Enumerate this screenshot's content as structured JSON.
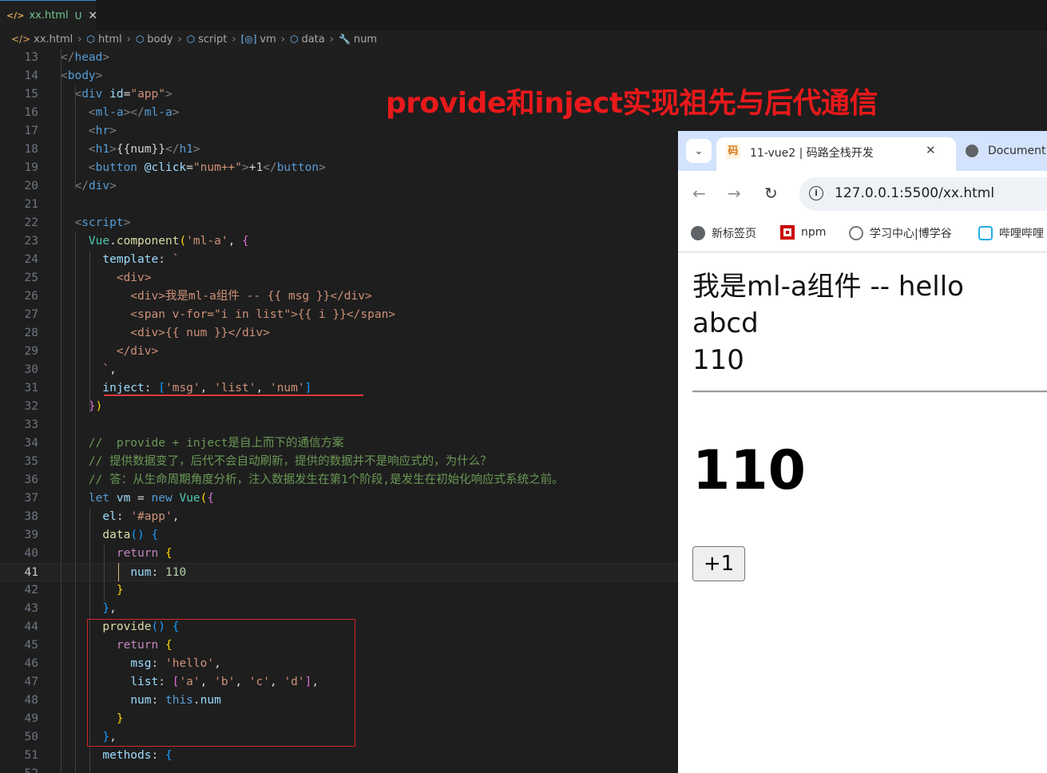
{
  "editor": {
    "tab": {
      "icon": "</>",
      "filename": "xx.html",
      "status": "U",
      "close": "✕"
    },
    "breadcrumb": [
      {
        "icon": "html-file-icon",
        "glyph": "</>",
        "label": "xx.html"
      },
      {
        "icon": "element-icon",
        "glyph": "⬡",
        "label": "html"
      },
      {
        "icon": "element-icon",
        "glyph": "⬡",
        "label": "body"
      },
      {
        "icon": "element-icon",
        "glyph": "⬡",
        "label": "script"
      },
      {
        "icon": "variable-icon",
        "glyph": "[◎]",
        "label": "vm"
      },
      {
        "icon": "element-icon",
        "glyph": "⬡",
        "label": "data"
      },
      {
        "icon": "wrench-icon",
        "glyph": "🔧",
        "label": "num"
      }
    ],
    "current_line": 41,
    "lines": [
      {
        "n": "13",
        "tokens": [
          [
            "br",
            "</"
          ],
          [
            "tg",
            "head"
          ],
          [
            "br",
            ">"
          ]
        ]
      },
      {
        "n": "14",
        "tokens": [
          [
            "br",
            "<"
          ],
          [
            "tg",
            "body"
          ],
          [
            "br",
            ">"
          ]
        ]
      },
      {
        "n": "15",
        "tokens": [
          [
            "",
            "  "
          ],
          [
            "br",
            "<"
          ],
          [
            "tg",
            "div"
          ],
          [
            "",
            " "
          ],
          [
            "at",
            "id"
          ],
          [
            "",
            "="
          ],
          [
            "st",
            "\"app\""
          ],
          [
            "br",
            ">"
          ]
        ]
      },
      {
        "n": "16",
        "tokens": [
          [
            "",
            "    "
          ],
          [
            "br",
            "<"
          ],
          [
            "tg",
            "ml-a"
          ],
          [
            "br",
            "></"
          ],
          [
            "tg",
            "ml-a"
          ],
          [
            "br",
            ">"
          ]
        ]
      },
      {
        "n": "17",
        "tokens": [
          [
            "",
            "    "
          ],
          [
            "br",
            "<"
          ],
          [
            "tg",
            "hr"
          ],
          [
            "br",
            ">"
          ]
        ]
      },
      {
        "n": "18",
        "tokens": [
          [
            "",
            "    "
          ],
          [
            "br",
            "<"
          ],
          [
            "tg",
            "h1"
          ],
          [
            "br",
            ">"
          ],
          [
            "",
            "{{num}}"
          ],
          [
            "br",
            "</"
          ],
          [
            "tg",
            "h1"
          ],
          [
            "br",
            ">"
          ]
        ]
      },
      {
        "n": "19",
        "tokens": [
          [
            "",
            "    "
          ],
          [
            "br",
            "<"
          ],
          [
            "tg",
            "button"
          ],
          [
            "",
            " "
          ],
          [
            "at",
            "@click"
          ],
          [
            "",
            "="
          ],
          [
            "st",
            "\"num++\""
          ],
          [
            "br",
            ">"
          ],
          [
            "",
            "+1"
          ],
          [
            "br",
            "</"
          ],
          [
            "tg",
            "button"
          ],
          [
            "br",
            ">"
          ]
        ]
      },
      {
        "n": "20",
        "tokens": [
          [
            "",
            "  "
          ],
          [
            "br",
            "</"
          ],
          [
            "tg",
            "div"
          ],
          [
            "br",
            ">"
          ]
        ]
      },
      {
        "n": "21",
        "tokens": []
      },
      {
        "n": "22",
        "tokens": [
          [
            "",
            "  "
          ],
          [
            "br",
            "<"
          ],
          [
            "tg",
            "script"
          ],
          [
            "br",
            ">"
          ]
        ]
      },
      {
        "n": "23",
        "tokens": [
          [
            "",
            "    "
          ],
          [
            "cl",
            "Vue"
          ],
          [
            "",
            "."
          ],
          [
            "fn",
            "component"
          ],
          [
            "yb",
            "("
          ],
          [
            "st",
            "'ml-a'"
          ],
          [
            ", "
          ],
          [
            "pb",
            "{"
          ]
        ]
      },
      {
        "n": "24",
        "tokens": [
          [
            "",
            "      "
          ],
          [
            "pr",
            "template"
          ],
          [
            "",
            ": "
          ],
          [
            "st",
            "`"
          ]
        ]
      },
      {
        "n": "25",
        "tokens": [
          [
            "st",
            "        <div>"
          ]
        ]
      },
      {
        "n": "26",
        "tokens": [
          [
            "st",
            "          <div>我是ml-a组件 -- {{ msg }}</div>"
          ]
        ]
      },
      {
        "n": "27",
        "tokens": [
          [
            "st",
            "          <span v-for=\"i in list\">{{ i }}</span>"
          ]
        ]
      },
      {
        "n": "28",
        "tokens": [
          [
            "st",
            "          <div>{{ num }}</div>"
          ]
        ]
      },
      {
        "n": "29",
        "tokens": [
          [
            "st",
            "        </div>"
          ]
        ]
      },
      {
        "n": "30",
        "tokens": [
          [
            "st",
            "      `"
          ],
          [
            "",
            ","
          ]
        ]
      },
      {
        "n": "31",
        "tokens": [
          [
            "",
            "      "
          ],
          [
            "pr",
            "inject"
          ],
          [
            "",
            ": "
          ],
          [
            "bb",
            "["
          ],
          [
            "st",
            "'msg'"
          ],
          [
            "",
            ", "
          ],
          [
            "st",
            "'list'"
          ],
          [
            "",
            ", "
          ],
          [
            "st",
            "'num'"
          ],
          [
            "bb",
            "]"
          ]
        ]
      },
      {
        "n": "32",
        "tokens": [
          [
            "",
            "    "
          ],
          [
            "pb",
            "}"
          ],
          [
            "yb",
            ")"
          ]
        ]
      },
      {
        "n": "33",
        "tokens": []
      },
      {
        "n": "34",
        "tokens": [
          [
            "",
            "    "
          ],
          [
            "cm",
            "//  provide + inject是自上而下的通信方案"
          ]
        ]
      },
      {
        "n": "35",
        "tokens": [
          [
            "",
            "    "
          ],
          [
            "cm",
            "// 提供数据变了，后代不会自动刷新，提供的数据并不是响应式的，为什么？"
          ]
        ]
      },
      {
        "n": "36",
        "tokens": [
          [
            "",
            "    "
          ],
          [
            "cm",
            "// 答：从生命周期角度分析，注入数据发生在第1个阶段,是发生在初始化响应式系统之前。"
          ]
        ]
      },
      {
        "n": "37",
        "tokens": [
          [
            "",
            "    "
          ],
          [
            "k2",
            "let"
          ],
          [
            "",
            " "
          ],
          [
            "pr",
            "vm"
          ],
          [
            "",
            " = "
          ],
          [
            "k2",
            "new"
          ],
          [
            "",
            " "
          ],
          [
            "cl",
            "Vue"
          ],
          [
            "yb",
            "("
          ],
          [
            "pb",
            "{"
          ]
        ]
      },
      {
        "n": "38",
        "tokens": [
          [
            "",
            "      "
          ],
          [
            "pr",
            "el"
          ],
          [
            "",
            ": "
          ],
          [
            "st",
            "'#app'"
          ],
          [
            "",
            ","
          ]
        ]
      },
      {
        "n": "39",
        "tokens": [
          [
            "",
            "      "
          ],
          [
            "fn",
            "data"
          ],
          [
            "bb",
            "()"
          ],
          [
            "",
            " "
          ],
          [
            "bb",
            "{"
          ]
        ]
      },
      {
        "n": "40",
        "tokens": [
          [
            "",
            "        "
          ],
          [
            "kw",
            "return"
          ],
          [
            "",
            " "
          ],
          [
            "yb",
            "{"
          ]
        ]
      },
      {
        "n": "41",
        "tokens": [
          [
            "",
            "          "
          ],
          [
            "pr",
            "num"
          ],
          [
            "",
            ": "
          ],
          [
            "nm",
            "110"
          ]
        ]
      },
      {
        "n": "42",
        "tokens": [
          [
            "",
            "        "
          ],
          [
            "yb",
            "}"
          ]
        ]
      },
      {
        "n": "43",
        "tokens": [
          [
            "",
            "      "
          ],
          [
            "bb",
            "}"
          ],
          [
            "",
            ","
          ]
        ]
      },
      {
        "n": "44",
        "tokens": [
          [
            "",
            "      "
          ],
          [
            "fn",
            "provide"
          ],
          [
            "bb",
            "()"
          ],
          [
            "",
            " "
          ],
          [
            "bb",
            "{"
          ]
        ]
      },
      {
        "n": "45",
        "tokens": [
          [
            "",
            "        "
          ],
          [
            "kw",
            "return"
          ],
          [
            "",
            " "
          ],
          [
            "yb",
            "{"
          ]
        ]
      },
      {
        "n": "46",
        "tokens": [
          [
            "",
            "          "
          ],
          [
            "pr",
            "msg"
          ],
          [
            "",
            ": "
          ],
          [
            "st",
            "'hello'"
          ],
          [
            "",
            ","
          ]
        ]
      },
      {
        "n": "47",
        "tokens": [
          [
            "",
            "          "
          ],
          [
            "pr",
            "list"
          ],
          [
            "",
            ": "
          ],
          [
            "pb",
            "["
          ],
          [
            "st",
            "'a'"
          ],
          [
            "",
            ", "
          ],
          [
            "st",
            "'b'"
          ],
          [
            "",
            ", "
          ],
          [
            "st",
            "'c'"
          ],
          [
            "",
            ", "
          ],
          [
            "st",
            "'d'"
          ],
          [
            "pb",
            "]"
          ],
          [
            "",
            ","
          ]
        ]
      },
      {
        "n": "48",
        "tokens": [
          [
            "",
            "          "
          ],
          [
            "pr",
            "num"
          ],
          [
            "",
            ": "
          ],
          [
            "k2",
            "this"
          ],
          [
            "",
            "."
          ],
          [
            "pr",
            "num"
          ]
        ]
      },
      {
        "n": "49",
        "tokens": [
          [
            "",
            "        "
          ],
          [
            "yb",
            "}"
          ]
        ]
      },
      {
        "n": "50",
        "tokens": [
          [
            "",
            "      "
          ],
          [
            "bb",
            "}"
          ],
          [
            "",
            ","
          ]
        ]
      },
      {
        "n": "51",
        "tokens": [
          [
            "",
            "      "
          ],
          [
            "pr",
            "methods"
          ],
          [
            "",
            ": "
          ],
          [
            "bb",
            "{"
          ]
        ]
      },
      {
        "n": "52",
        "tokens": []
      }
    ]
  },
  "annotation": {
    "title": "provide和inject实现祖先与后代通信",
    "color": "#e8191b"
  },
  "browser": {
    "tab_title": "11-vue2 | 码路全栈开发",
    "tab_favicon": "码",
    "tab_close": "✕",
    "tab2_title": "Document",
    "dropdown_glyph": "⌄",
    "back_glyph": "←",
    "forward_glyph": "→",
    "reload_glyph": "↻",
    "info_glyph": "i",
    "url": "127.0.0.1:5500/xx.html",
    "bookmarks": [
      "新标签页",
      "npm",
      "学习中心|博学谷",
      "哔哩哔哩"
    ],
    "page": {
      "component_line": "我是ml-a组件 -- hello",
      "list_line": "abcd",
      "num_line": "110",
      "h1": "110",
      "button": "+1"
    }
  }
}
